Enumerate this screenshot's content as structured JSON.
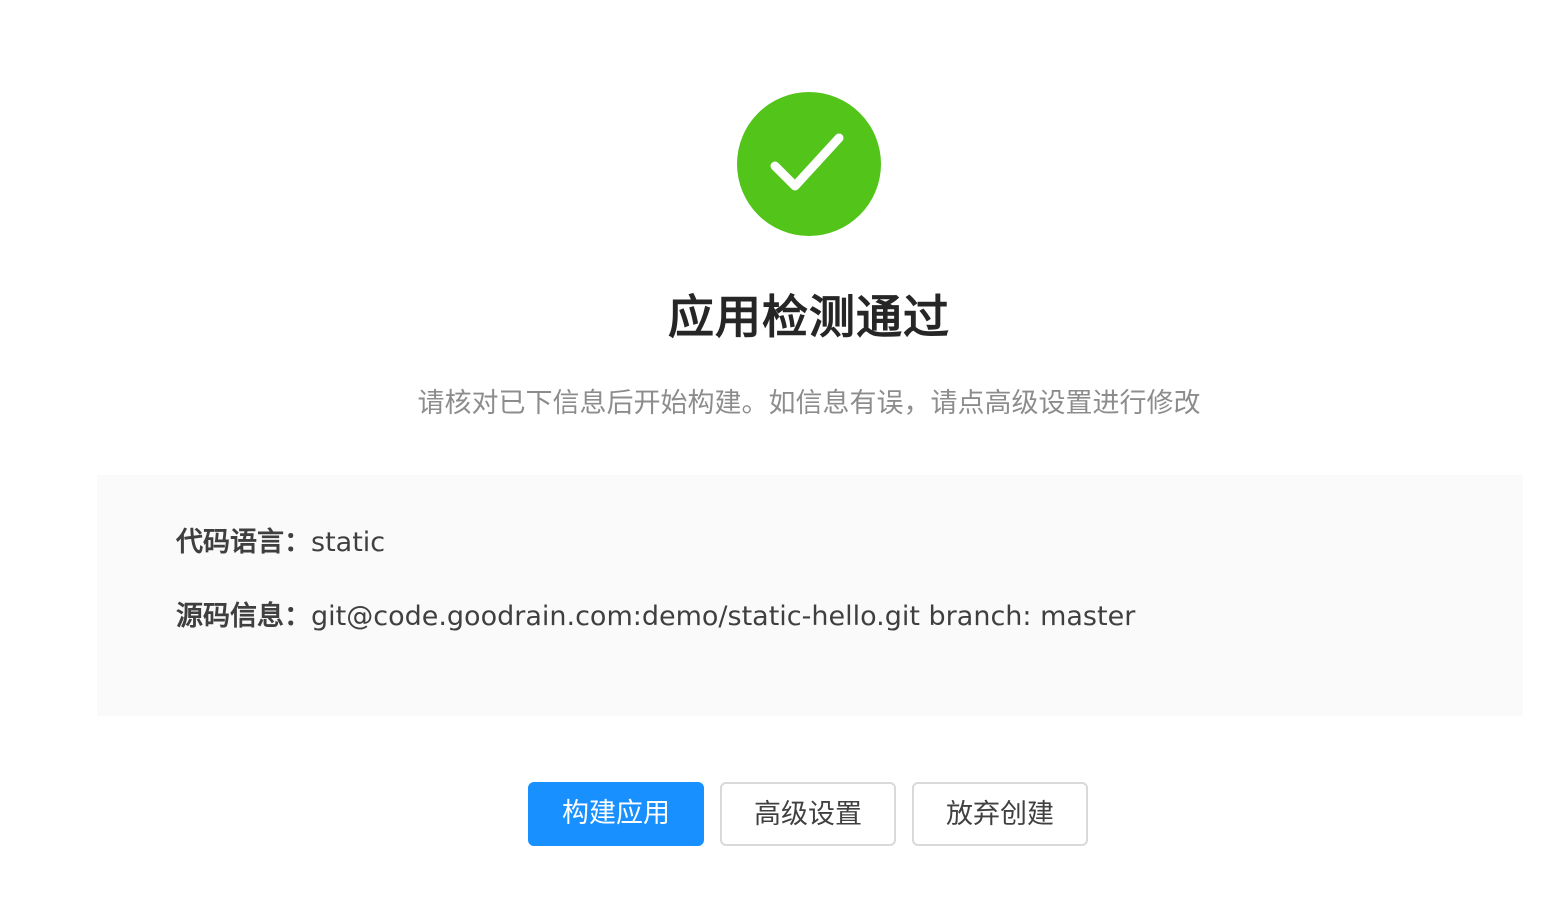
{
  "result": {
    "status": "success",
    "icon": "check-circle-icon",
    "icon_color": "#52c41a",
    "title": "应用检测通过",
    "description": "请核对已下信息后开始构建。如信息有误，请点高级设置进行修改"
  },
  "info": {
    "language_label": "代码语言：",
    "language_value": "static",
    "source_label": "源码信息：",
    "source_value": "git@code.goodrain.com:demo/static-hello.git branch: master"
  },
  "actions": {
    "build_label": "构建应用",
    "advanced_label": "高级设置",
    "abandon_label": "放弃创建",
    "primary_color": "#1890ff"
  }
}
